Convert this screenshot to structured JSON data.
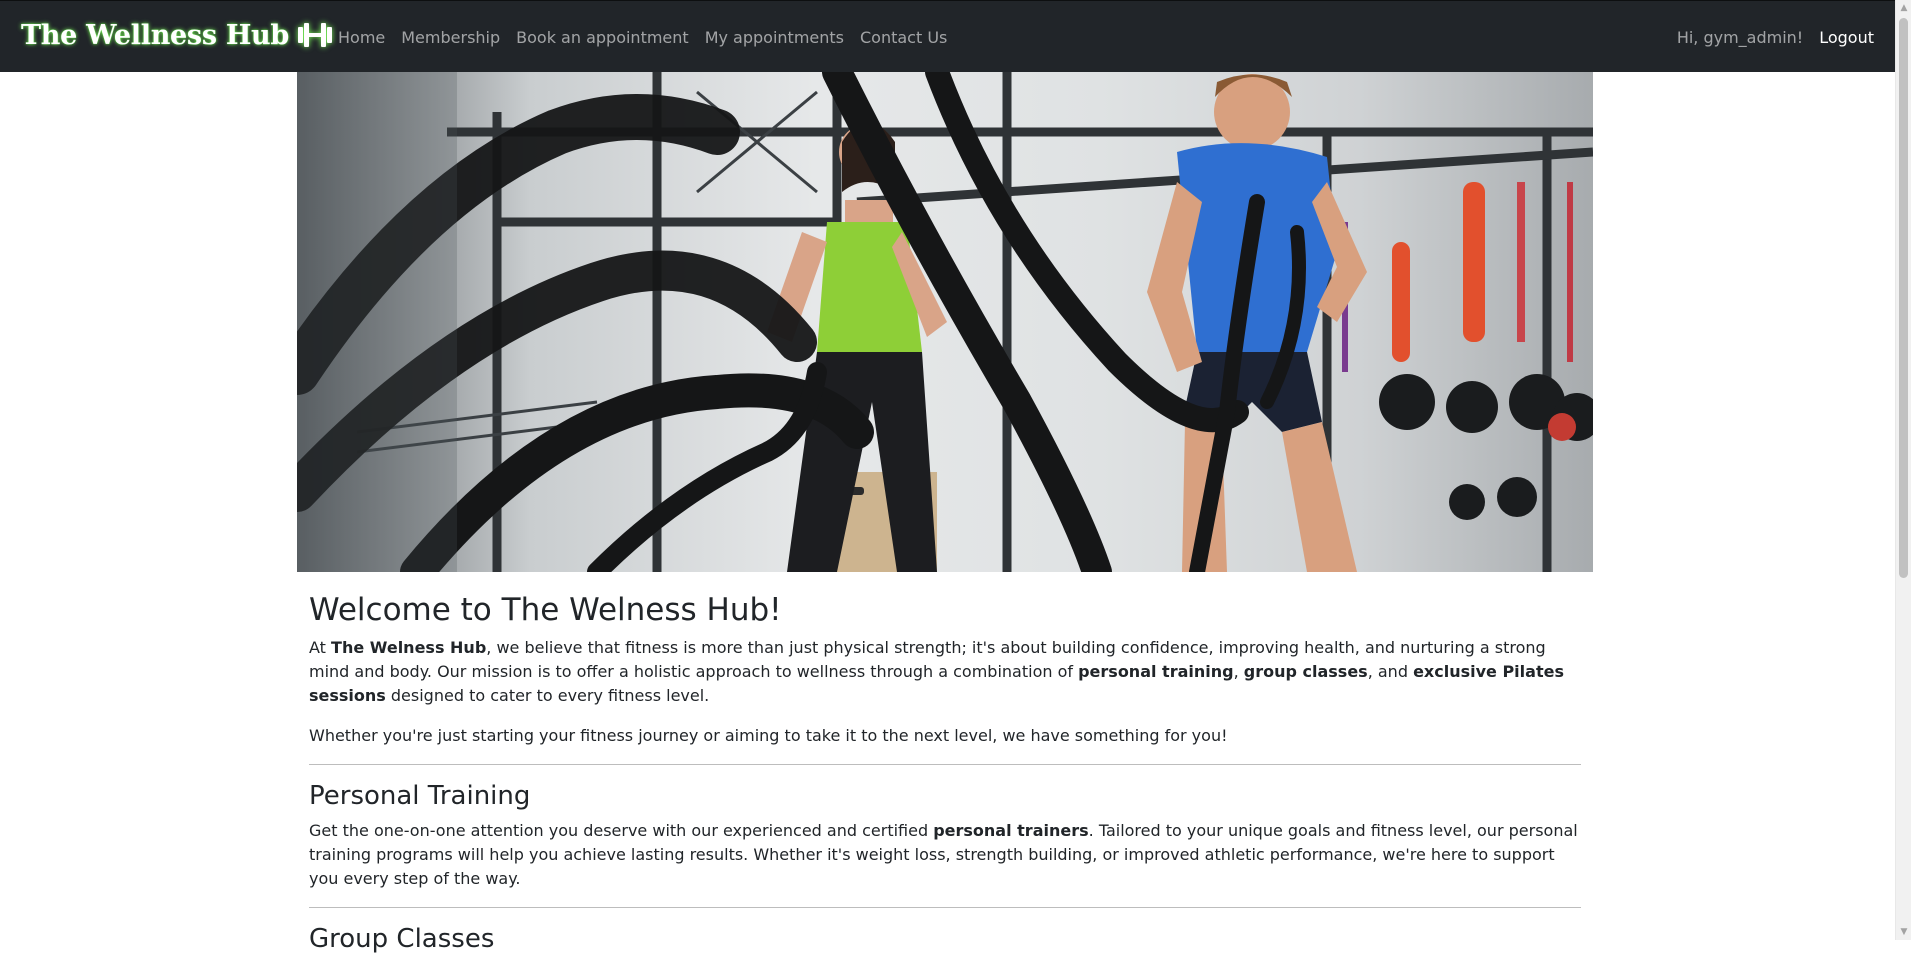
{
  "brand": {
    "name": "The Wellness Hub"
  },
  "nav": {
    "links": [
      "Home",
      "Membership",
      "Book an appointment",
      "My appointments",
      "Contact Us"
    ],
    "greeting": "Hi, gym_admin!",
    "logout": "Logout"
  },
  "hero": {
    "alt_icon": "hero-photo"
  },
  "welcome": {
    "title": "Welcome to The Welness Hub!",
    "p1_a": "At ",
    "p1_b": "The Welness Hub",
    "p1_c": ", we believe that fitness is more than just physical strength; it's about building confidence, improving health, and nurturing a strong mind and body. Our mission is to offer a holistic approach to wellness through a combination of ",
    "p1_d": "personal training",
    "p1_e": ", ",
    "p1_f": "group classes",
    "p1_g": ", and ",
    "p1_h": "exclusive Pilates sessions",
    "p1_i": " designed to cater to every fitness level.",
    "p2": "Whether you're just starting your fitness journey or aiming to take it to the next level, we have something for you!"
  },
  "personal_training": {
    "title": "Personal Training",
    "p_a": "Get the one-on-one attention you deserve with our experienced and certified ",
    "p_b": "personal trainers",
    "p_c": ". Tailored to your unique goals and fitness level, our personal training programs will help you achieve lasting results. Whether it's weight loss, strength building, or improved athletic performance, we're here to support you every step of the way."
  },
  "group_classes": {
    "title": "Group Classes"
  },
  "colors": {
    "navbar": "#212529",
    "text": "#212529",
    "brand_glow": "#7dff5a"
  }
}
